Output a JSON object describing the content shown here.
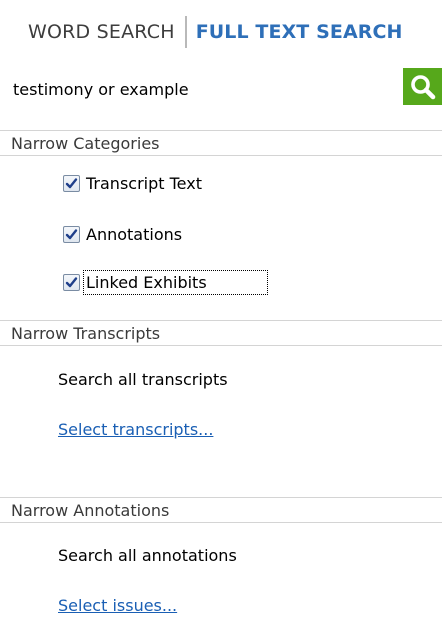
{
  "tabs": {
    "word_search": "WORD SEARCH",
    "full_text_search": "FULL TEXT SEARCH"
  },
  "search": {
    "query": "testimony or example",
    "button_icon": "search-icon",
    "accent_color": "#56a81b"
  },
  "categories": {
    "title": "Narrow Categories",
    "items": [
      {
        "label": "Transcript Text",
        "checked": true
      },
      {
        "label": "Annotations",
        "checked": true
      },
      {
        "label": "Linked Exhibits",
        "checked": true
      }
    ]
  },
  "transcripts": {
    "title": "Narrow Transcripts",
    "status": "Search all transcripts",
    "link": "Select transcripts..."
  },
  "annotations": {
    "title": "Narrow Annotations",
    "status": "Search all annotations",
    "link": "Select issues..."
  }
}
